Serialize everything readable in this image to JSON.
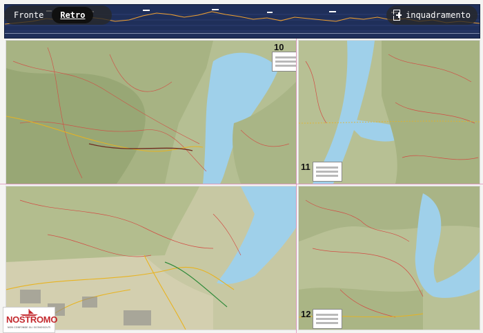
{
  "toolbar": {
    "tabs": [
      {
        "label": "Fronte",
        "active": false
      },
      {
        "label": "Retro",
        "active": true
      }
    ],
    "crop_label": "inquadramento",
    "crop_icon": "crop-frame-icon"
  },
  "map": {
    "sheets": [
      {
        "number": "10"
      },
      {
        "number": "11"
      },
      {
        "number": "12"
      }
    ],
    "accent_colors": {
      "lake": "#9fd0ea",
      "trail": "#d24b43",
      "road": "#e8b320",
      "cut_line": "#d86aa8",
      "profile_bg": "#1f2f5a"
    }
  },
  "brand": {
    "name": "NOSTROMO",
    "tagline": "NON CONFONDE GLI SCONOSCIUTI"
  }
}
